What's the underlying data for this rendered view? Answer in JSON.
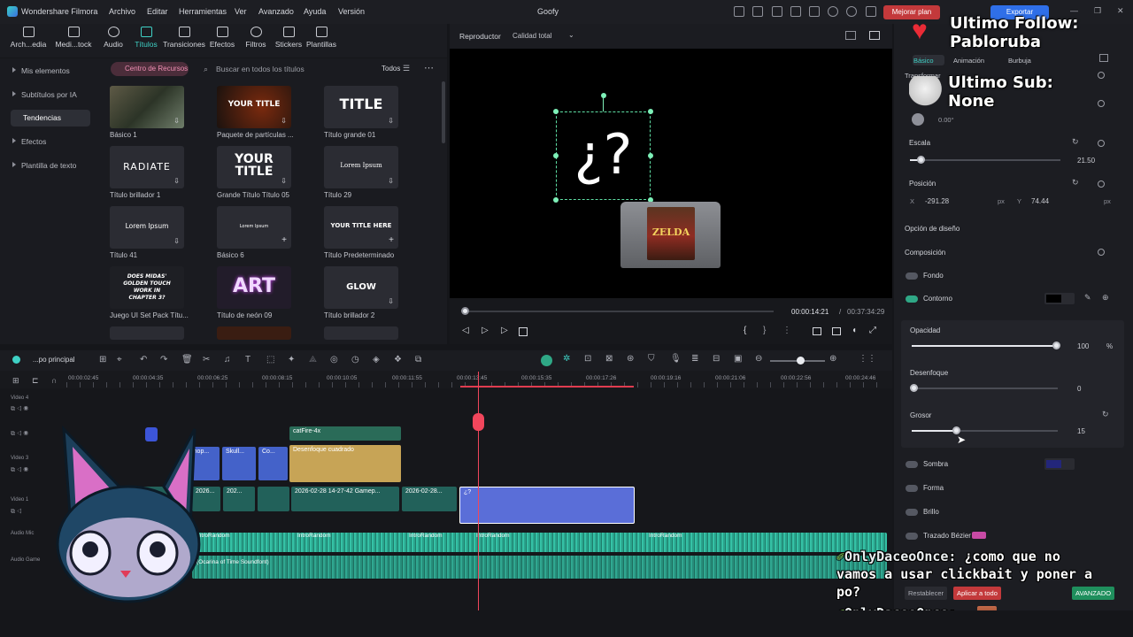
{
  "titlebar": {
    "app_name": "Wondershare Filmora",
    "menus": [
      "Archivo",
      "Editar",
      "Herramientas",
      "Ver",
      "Avanzado",
      "Ayuda",
      "Versión"
    ],
    "project_title": "Goofy",
    "upgrade_label": "Mejorar plan",
    "export_label": "Exportar"
  },
  "toolbar": {
    "tools": [
      "Arch...edia",
      "Medi...tock",
      "Audio",
      "Títulos",
      "Transiciones",
      "Efectos",
      "Filtros",
      "Stickers",
      "Plantillas"
    ]
  },
  "library": {
    "sidebar": [
      "Mis elementos",
      "Subtítulos por IA",
      "Tendencias",
      "Efectos",
      "Plantilla de texto"
    ],
    "resource_tab": "Centro de Recursos",
    "search_placeholder": "Buscar en todos los títulos",
    "filter_label": "Todos",
    "items": [
      {
        "label": "Básico 1",
        "text": ""
      },
      {
        "label": "Paquete de partículas ...",
        "text": "YOUR TITLE"
      },
      {
        "label": "Título grande 01",
        "text": "TITLE"
      },
      {
        "label": "Título brillador 1",
        "text": "RADIATE"
      },
      {
        "label": "Grande Título Título 05",
        "text": "YOUR TITLE"
      },
      {
        "label": "Título 29",
        "text": "Lorem Ipsum"
      },
      {
        "label": "Título 41",
        "text": "Lorem Ipsum"
      },
      {
        "label": "Básico 6",
        "text": "Lorem Ipsum"
      },
      {
        "label": "Título Predeterminado",
        "text": "YOUR TITLE HERE"
      },
      {
        "label": "Juego UI Set Pack Títu...",
        "text": "DOES MIDAS' GOLDEN TOUCH WORK IN CHAPTER 3?"
      },
      {
        "label": "Título de neón 09",
        "text": "ART"
      },
      {
        "label": "Título brillador 2",
        "text": "GLOW"
      }
    ]
  },
  "player": {
    "label": "Reproductor",
    "quality": "Calidad total",
    "overlay_text": "¿?",
    "cartridge_text": "ZELDA",
    "current_time": "00:00:14:21",
    "total_time": "00:37:34:29"
  },
  "props": {
    "tabs": [
      "Básico",
      "Animación",
      "Burbuja"
    ],
    "transform_label": "Transformar",
    "rotation_value": "0.00°",
    "scale_label": "Escala",
    "scale_value": "21.50",
    "position_label": "Posición",
    "pos_x_label": "X",
    "pos_x": "-291.28",
    "pos_y_label": "Y",
    "pos_y": "74.44",
    "unit_px": "px",
    "design_label": "Opción de diseño",
    "composition_label": "Composición",
    "fondo_label": "Fondo",
    "contorno_label": "Contorno",
    "opacity_label": "Opacidad",
    "opacity_value": "100",
    "opacity_unit": "%",
    "blur_label": "Desenfoque",
    "blur_value": "0",
    "thickness_label": "Grosor",
    "thickness_value": "15",
    "shadow_label": "Sombra",
    "shape_label": "Forma",
    "glow_label": "Brillo",
    "bezier_label": "Trazado Bézier",
    "reset_label": "Restablecer",
    "apply_all_label": "Aplicar a todo",
    "advanced_label": "AVANZADO"
  },
  "stream_overlay": {
    "follow_line1": "Ultimo Follow:",
    "follow_line2": "Pabloruba",
    "sub_line1": "Ultimo Sub:",
    "sub_line2": "None",
    "chat": [
      {
        "user": "OnlyDaceoOnce:",
        "text": "¿como que no"
      },
      {
        "user": "",
        "text": "vamos a usar clickbait y poner a"
      },
      {
        "user": "",
        "text": "po?"
      },
      {
        "user": "OnlyDaceoOnce:",
        "text": ""
      }
    ]
  },
  "timeline": {
    "track_selector": "...po principal",
    "times": [
      "00:00:02:45",
      "00:00:04:35",
      "00:00:06:25",
      "00:00:08:15",
      "00:00:10:05",
      "00:00:11:55",
      "00:00:13:45",
      "00:00:15:35",
      "00:00:17:26",
      "00:00:19:16",
      "00:00:21:06",
      "00:00:22:56",
      "00:00:24:46"
    ],
    "tracks": [
      "Video 4",
      "Video 3",
      "Video 2",
      "Video 1",
      "Audio Mic",
      "Audio Game"
    ],
    "clips": {
      "catfire": "catFire-4x",
      "blur_fx": "Desenfoque cuadrado",
      "shop": "Shop...",
      "skull": "Skull...",
      "co": "Co...",
      "gameplay": "2026-02-28 14-27-42 Gamep...",
      "clip_a": "2026...",
      "clip_b": "202...",
      "clip_c": "2026-02-28...",
      "title_clip": "¿?",
      "audio_label": "IntroRandom",
      "audio_soundtrack": "(Ocarina of Time Soundfont)"
    }
  }
}
